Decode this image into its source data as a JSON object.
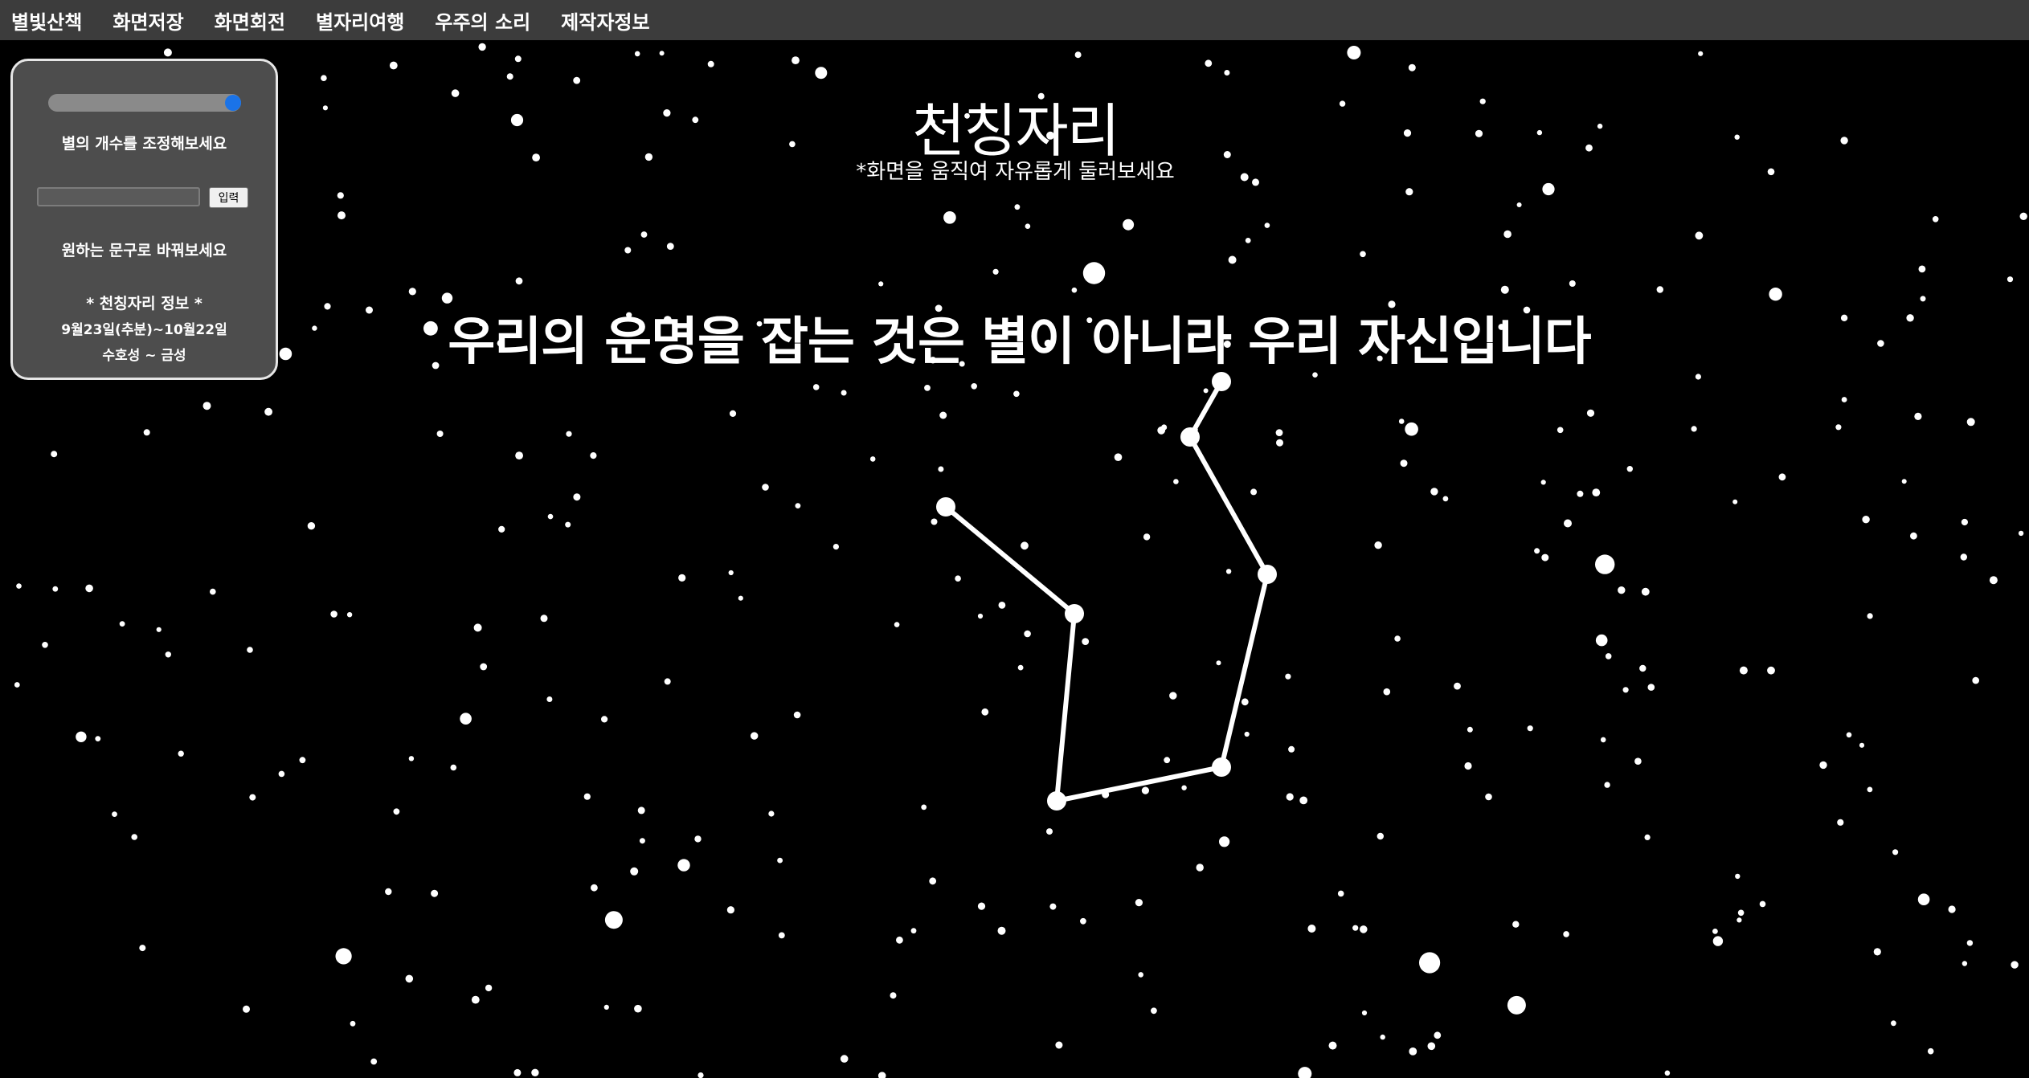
{
  "menu": {
    "items": [
      "별빛산책",
      "화면저장",
      "화면회전",
      "별자리여행",
      "우주의 소리",
      "제작자정보"
    ]
  },
  "panel": {
    "slider_caption": "별의 개수를 조정해보세요",
    "slider_value_fraction": 1.0,
    "input_value": "",
    "submit_label": "입력",
    "input_caption": "원하는 문구로 바꿔보세요",
    "info_heading": "* 천칭자리 정보 *",
    "info_dates": "9월23일(추분)~10월22일",
    "info_planet": "수호성 ~ 금성"
  },
  "header": {
    "title": "천칭자리",
    "subtitle": "*화면을 움직여 자유롭게 둘러보세요"
  },
  "quote": "우리의 운명을 잡는 것은 별이 아니라 우리 자신입니다",
  "colors": {
    "background": "#000000",
    "menubar": "#3c3c3c",
    "panel": "#4d4d4d",
    "panel_border": "#e6e6e6",
    "slider_thumb": "#1a73e8",
    "star": "#ffffff"
  }
}
